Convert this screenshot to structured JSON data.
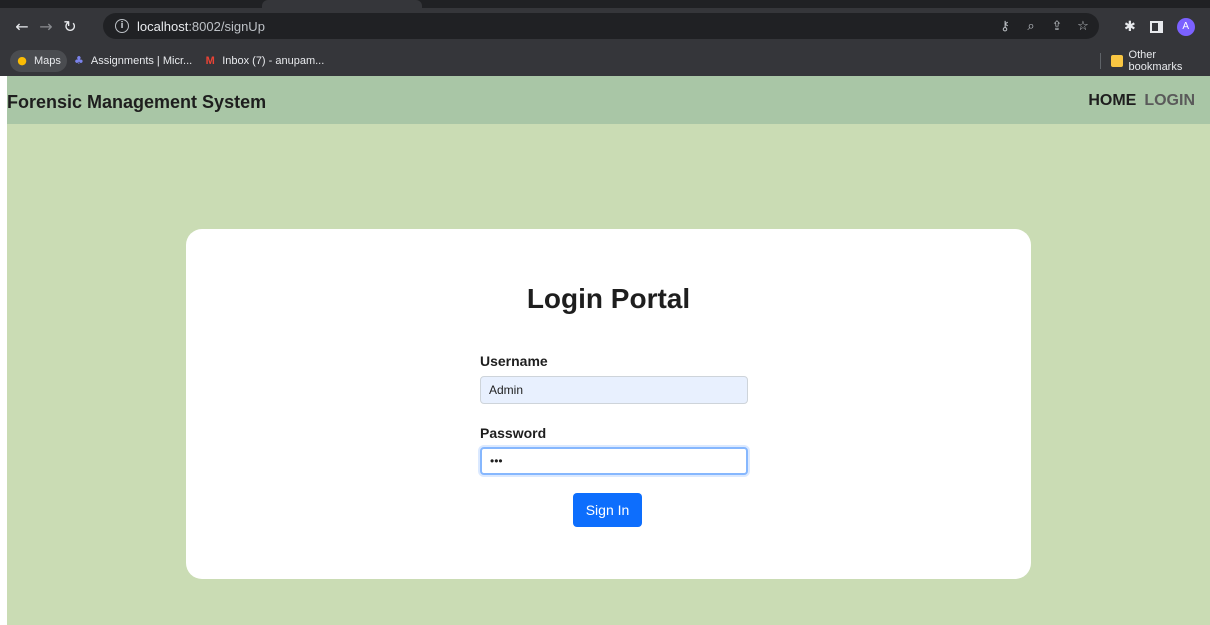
{
  "browser": {
    "url_host": "localhost",
    "url_path": ":8002/signUp",
    "bookmarks": [
      {
        "label": "Maps",
        "icon": "maps-icon"
      },
      {
        "label": "Assignments | Micr...",
        "icon": "teams-icon"
      },
      {
        "label": "Inbox (7) - anupam...",
        "icon": "gmail-icon"
      }
    ],
    "other_bookmarks": "Other bookmarks",
    "profile_initial": "A"
  },
  "navbar": {
    "brand": "Forensic Management System",
    "links": [
      "HOME",
      "LOGIN"
    ]
  },
  "login": {
    "title": "Login Portal",
    "username_label": "Username",
    "username_value": "Admin",
    "password_label": "Password",
    "password_value": "•••",
    "submit_label": "Sign In"
  },
  "colors": {
    "page_bg": "#cadcb4",
    "navbar_bg": "#a9c6a6",
    "button": "#0d6efd"
  }
}
